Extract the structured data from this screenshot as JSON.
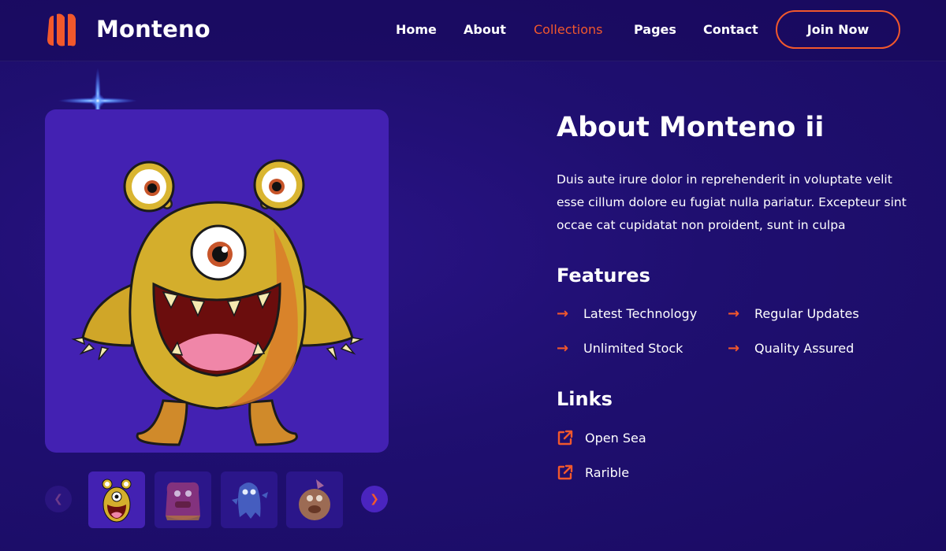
{
  "brand": {
    "name": "Monteno",
    "accent": "#f2582c"
  },
  "nav": {
    "items": [
      {
        "label": "Home"
      },
      {
        "label": "About"
      },
      {
        "label": "Collections",
        "active": true
      },
      {
        "label": "Pages"
      },
      {
        "label": "Contact"
      }
    ],
    "cta": "Join Now"
  },
  "gallery": {
    "main_image": "yellow-monster",
    "thumbnails": [
      "yellow-monster",
      "pink-monster",
      "blue-ghost-monster",
      "brown-monster"
    ],
    "selected_index": 0
  },
  "about": {
    "title": "About Monteno ii",
    "description": "Duis aute irure dolor in reprehenderit in voluptate velit esse cillum dolore eu fugiat nulla pariatur. Excepteur sint occae cat cupidatat non proident, sunt in culpa"
  },
  "features": {
    "title": "Features",
    "items": [
      "Latest Technology",
      "Regular Updates",
      "Unlimited Stock",
      "Quality Assured"
    ]
  },
  "links": {
    "title": "Links",
    "items": [
      "Open Sea",
      "Rarible"
    ]
  }
}
